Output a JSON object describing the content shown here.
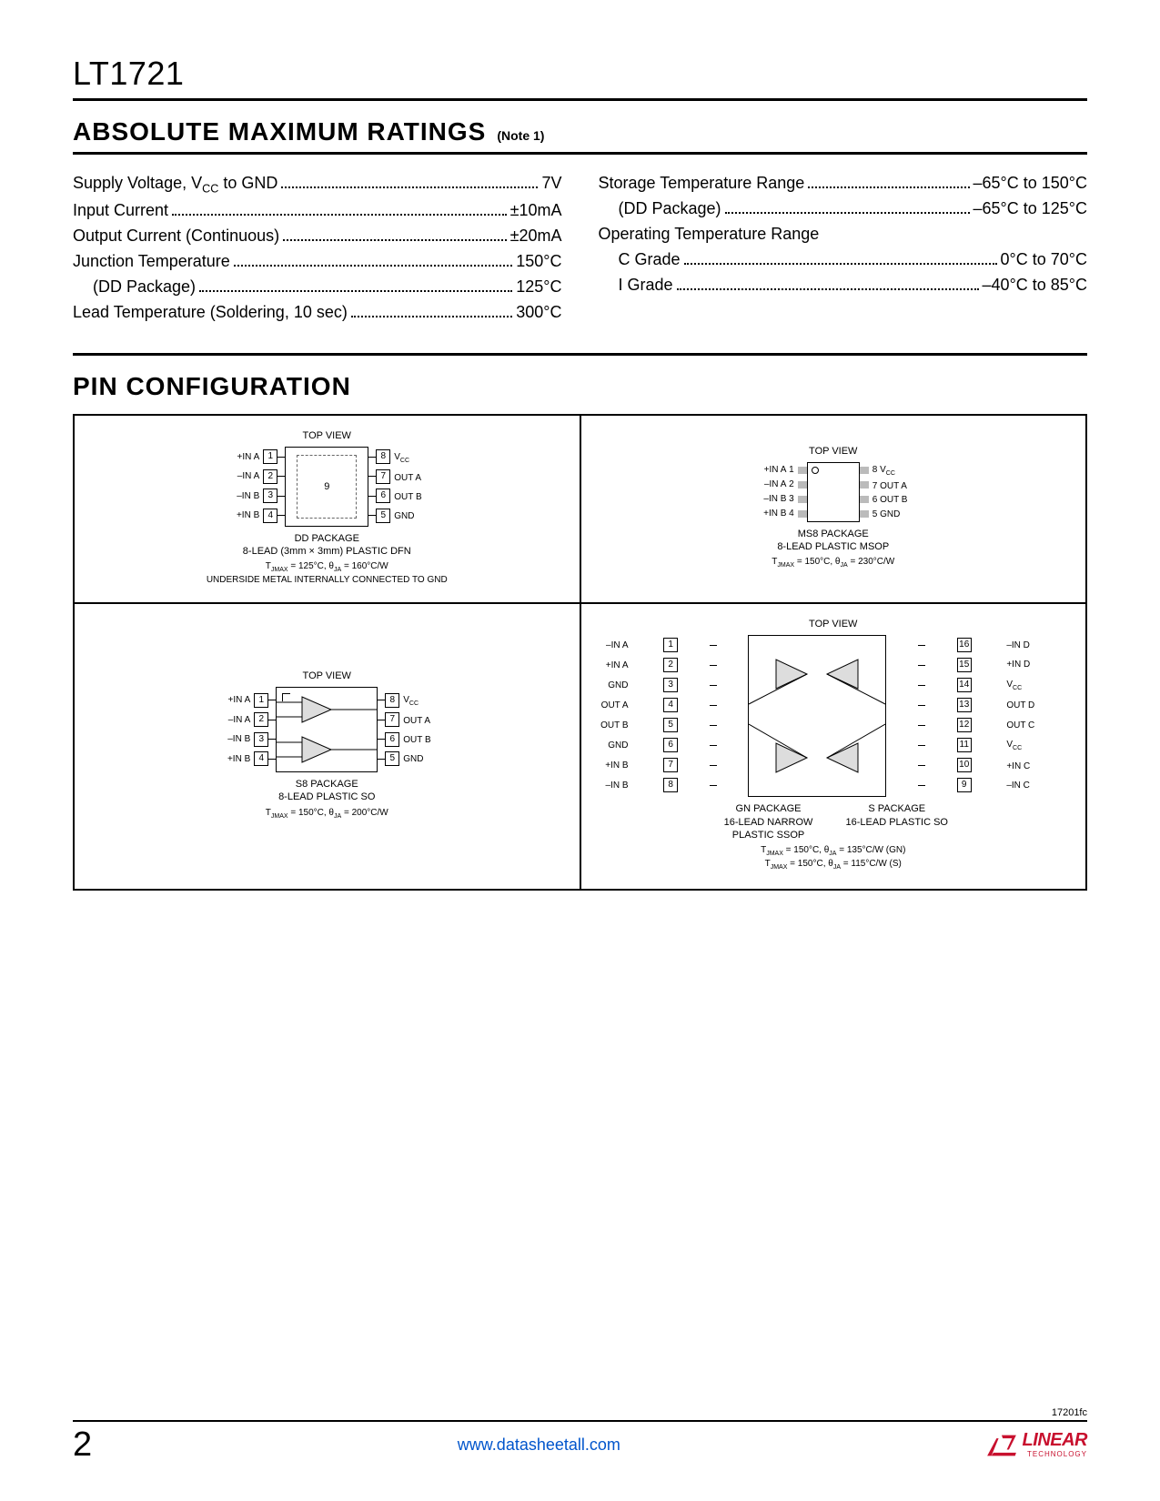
{
  "part_number": "LT1721",
  "sections": {
    "ratings_title": "ABSOLUTE MAXIMUM RATINGS",
    "ratings_note": "(Note 1)",
    "pin_config_title": "PIN CONFIGURATION"
  },
  "ratings_left": [
    {
      "label": "Supply Voltage, V_CC to GND",
      "value": "7V",
      "indent": false
    },
    {
      "label": "Input Current",
      "value": "±10mA",
      "indent": false
    },
    {
      "label": "Output Current (Continuous)",
      "value": "±20mA",
      "indent": false
    },
    {
      "label": "Junction Temperature",
      "value": "150°C",
      "indent": false
    },
    {
      "label": "(DD Package)",
      "value": "125°C",
      "indent": true
    },
    {
      "label": "Lead Temperature (Soldering, 10 sec)",
      "value": "300°C",
      "indent": false
    }
  ],
  "ratings_right": [
    {
      "label": "Storage Temperature Range",
      "value": "–65°C to 150°C",
      "indent": false
    },
    {
      "label": "(DD Package)",
      "value": "–65°C to 125°C",
      "indent": true
    },
    {
      "label": "Operating Temperature Range",
      "value": "",
      "indent": false
    },
    {
      "label": "C Grade",
      "value": "0°C to 70°C",
      "indent": true
    },
    {
      "label": "I Grade",
      "value": "–40°C to 85°C",
      "indent": true
    }
  ],
  "packages": {
    "dd": {
      "top_view": "TOP VIEW",
      "name": "DD PACKAGE",
      "desc": "8-LEAD (3mm × 3mm) PLASTIC DFN",
      "thermal": "T_JMAX = 125°C, θ_JA = 160°C/W",
      "note": "UNDERSIDE METAL INTERNALLY CONNECTED TO GND",
      "center_pad": "9",
      "pins_left": [
        "+IN A",
        "–IN A",
        "–IN B",
        "+IN B"
      ],
      "pins_left_num": [
        "1",
        "2",
        "3",
        "4"
      ],
      "pins_right": [
        "V_CC",
        "OUT A",
        "OUT B",
        "GND"
      ],
      "pins_right_num": [
        "8",
        "7",
        "6",
        "5"
      ]
    },
    "ms8": {
      "top_view": "TOP VIEW",
      "name": "MS8 PACKAGE",
      "desc": "8-LEAD PLASTIC MSOP",
      "thermal": "T_JMAX = 150°C, θ_JA = 230°C/W",
      "pins_left": [
        "+IN A",
        "–IN A",
        "–IN B",
        "+IN B"
      ],
      "pins_left_num": [
        "1",
        "2",
        "3",
        "4"
      ],
      "pins_right": [
        "V_CC",
        "OUT A",
        "OUT B",
        "GND"
      ],
      "pins_right_num": [
        "8",
        "7",
        "6",
        "5"
      ]
    },
    "s8": {
      "top_view": "TOP VIEW",
      "name": "S8 PACKAGE",
      "desc": "8-LEAD PLASTIC SO",
      "thermal": "T_JMAX = 150°C, θ_JA = 200°C/W",
      "pins_left": [
        "+IN A",
        "–IN A",
        "–IN B",
        "+IN B"
      ],
      "pins_left_num": [
        "1",
        "2",
        "3",
        "4"
      ],
      "pins_right": [
        "V_CC",
        "OUT A",
        "OUT B",
        "GND"
      ],
      "pins_right_num": [
        "8",
        "7",
        "6",
        "5"
      ]
    },
    "gn_s16": {
      "top_view": "TOP VIEW",
      "name_left": "GN PACKAGE",
      "desc_left": "16-LEAD NARROW PLASTIC SSOP",
      "name_right": "S PACKAGE",
      "desc_right": "16-LEAD PLASTIC SO",
      "thermal1": "T_JMAX = 150°C, θ_JA = 135°C/W (GN)",
      "thermal2": "T_JMAX = 150°C, θ_JA = 115°C/W (S)",
      "pins_left": [
        "–IN A",
        "+IN A",
        "GND",
        "OUT A",
        "OUT B",
        "GND",
        "+IN B",
        "–IN B"
      ],
      "pins_left_num": [
        "1",
        "2",
        "3",
        "4",
        "5",
        "6",
        "7",
        "8"
      ],
      "pins_right": [
        "–IN D",
        "+IN D",
        "V_CC",
        "OUT D",
        "OUT C",
        "V_CC",
        "+IN C",
        "–IN C"
      ],
      "pins_right_num": [
        "16",
        "15",
        "14",
        "13",
        "12",
        "11",
        "10",
        "9"
      ]
    }
  },
  "footer": {
    "doc_code": "17201fc",
    "page_number": "2",
    "link": "www.datasheetall.com",
    "logo_text": "LINEAR",
    "logo_sub": "TECHNOLOGY"
  }
}
